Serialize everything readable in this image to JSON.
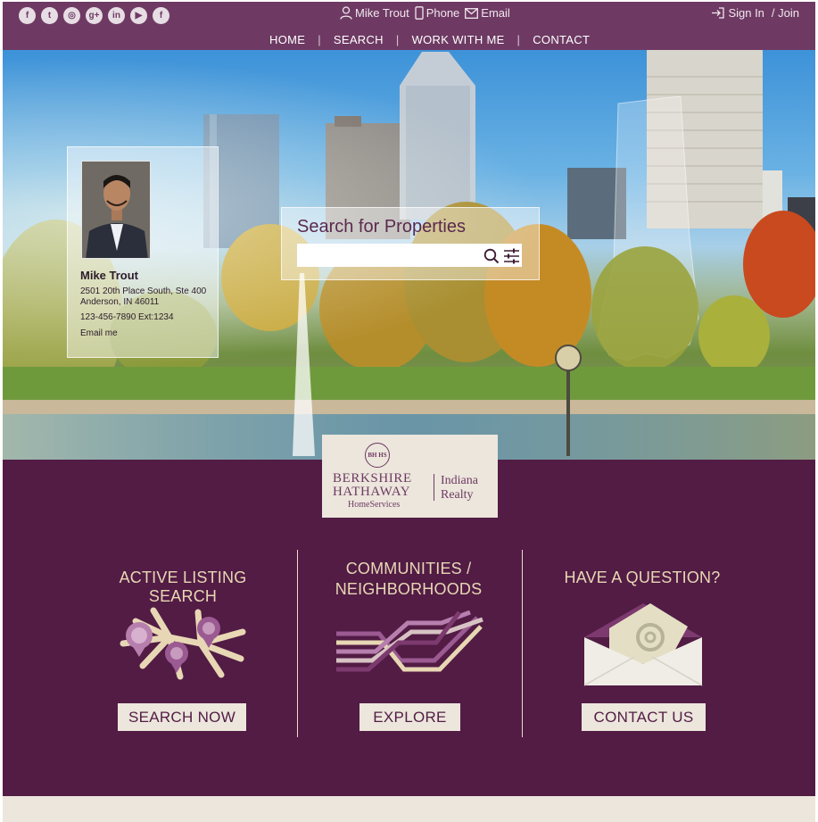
{
  "header": {
    "social_icons": [
      "facebook-icon",
      "twitter-icon",
      "instagram-icon",
      "google-plus-icon",
      "linkedin-icon",
      "youtube-icon",
      "facebook-icon"
    ],
    "social_glyphs": [
      "f",
      "t",
      "◎",
      "g+",
      "in",
      "▶",
      "f"
    ],
    "user_name": "Mike Trout",
    "phone_label": "Phone",
    "email_label": "Email",
    "sign_in_label": "Sign In",
    "join_label": "/ Join"
  },
  "nav": {
    "items": [
      "HOME",
      "SEARCH",
      "WORK WITH ME",
      "CONTACT"
    ],
    "separator": "|"
  },
  "agent": {
    "name": "Mike Trout",
    "address_line1": "2501 20th Place South, Ste 400",
    "address_line2": "Anderson, IN 46011",
    "phone": "123-456-7890 Ext:1234",
    "email_link": "Email me"
  },
  "search": {
    "title": "Search for Properties",
    "value": ""
  },
  "logo": {
    "seal": "BH HS",
    "brand_line1": "BERKSHIRE",
    "brand_line2": "HATHAWAY",
    "brand_sub": "HomeServices",
    "region_line1": "Indiana",
    "region_line2": "Realty"
  },
  "sections": [
    {
      "title": "ACTIVE LISTING SEARCH",
      "button": "SEARCH NOW",
      "icon": "map-pins-icon"
    },
    {
      "title_line1": "COMMUNITIES /",
      "title_line2": "NEIGHBORHOODS",
      "button": "EXPLORE",
      "icon": "roads-icon"
    },
    {
      "title": "HAVE A QUESTION?",
      "button": "CONTACT US",
      "icon": "envelope-icon"
    }
  ],
  "colors": {
    "brand_plum": "#521c45",
    "header_plum": "#6e3a63",
    "cream": "#ece6dc",
    "accent_gold": "#e8d7b4"
  }
}
